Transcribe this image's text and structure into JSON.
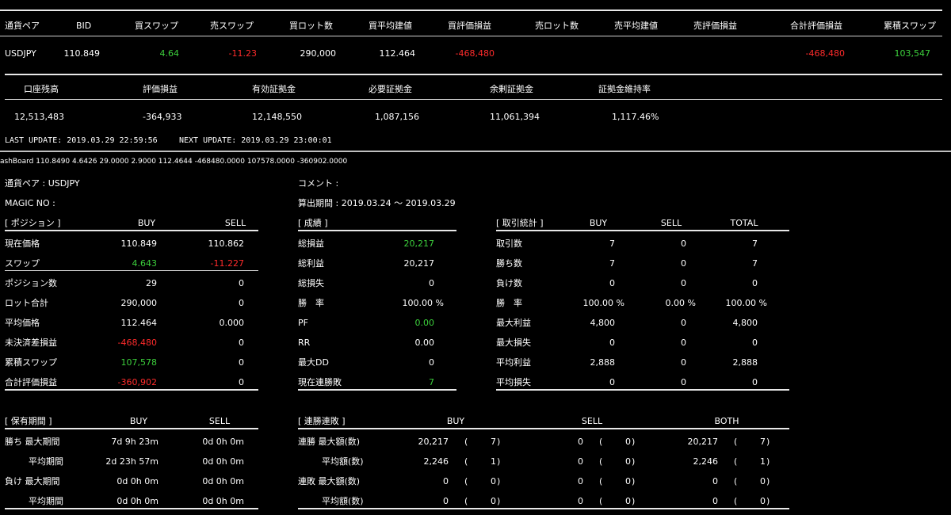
{
  "pos_header": [
    "通貨ペア",
    "BID",
    "買スワップ",
    "売スワップ",
    "買ロット数",
    "買平均建値",
    "買評価損益",
    "売ロット数",
    "売平均建値",
    "売評価損益",
    "合計評価損益",
    "累積スワップ"
  ],
  "pos_row": [
    "USDJPY",
    "110.849",
    "4.64",
    "-11.23",
    "290,000",
    "112.464",
    "-468,480",
    "",
    "",
    "",
    "-468,480",
    "103,547"
  ],
  "acct_header": [
    "口座残高",
    "評価損益",
    "有効証拠金",
    "必要証拠金",
    "余剰証拠金",
    "証拠金維持率"
  ],
  "acct_row": [
    "12,513,483",
    "-364,933",
    "12,148,550",
    "1,087,156",
    "11,061,394",
    "1,117.46%"
  ],
  "update": {
    "last": "LAST UPDATE: 2019.03.29 22:59:56",
    "next": "NEXT UPDATE: 2019.03.29 23:00:01"
  },
  "status_line": "ashBoard 110.8490 4.6426 29.0000 2.9000 112.4644 -468480.0000 107578.0000 -360902.0000",
  "info": {
    "pair": "通貨ペア : USDJPY",
    "magic": "MAGIC NO :",
    "comment": "コメント :",
    "period": "算出期間 : 2019.03.24 ～ 2019.03.29"
  },
  "position": {
    "title": "[ ポジション ]",
    "buy": "BUY",
    "sell": "SELL",
    "rows": [
      [
        "現在価格",
        "110.849",
        "110.862"
      ],
      [
        "スワップ",
        "4.643",
        "-11.227"
      ],
      [
        "ポジション数",
        "29",
        "0"
      ],
      [
        "ロット合計",
        "290,000",
        "0"
      ],
      [
        "平均価格",
        "112.464",
        "0.000"
      ],
      [
        "未決済差損益",
        "-468,480",
        "0"
      ],
      [
        "累積スワップ",
        "107,578",
        "0"
      ],
      [
        "合計評価損益",
        "-360,902",
        "0"
      ]
    ]
  },
  "results": {
    "title": "[ 成績 ]",
    "rows": [
      [
        "総損益",
        "20,217"
      ],
      [
        "総利益",
        "20,217"
      ],
      [
        "総損失",
        "0"
      ],
      [
        "勝　率",
        "100.00 %"
      ],
      [
        "PF",
        "0.00"
      ],
      [
        "RR",
        "0.00"
      ],
      [
        "最大DD",
        "0"
      ],
      [
        "現在連勝敗",
        "7"
      ]
    ]
  },
  "trade_stats": {
    "title": "[ 取引統計 ]",
    "buy": "BUY",
    "sell": "SELL",
    "total": "TOTAL",
    "rows": [
      [
        "取引数",
        "7",
        "0",
        "7"
      ],
      [
        "勝ち数",
        "7",
        "0",
        "7"
      ],
      [
        "負け数",
        "0",
        "0",
        "0"
      ],
      [
        "勝　率",
        "100.00 %",
        "0.00 %",
        "100.00 %"
      ],
      [
        "最大利益",
        "4,800",
        "0",
        "4,800"
      ],
      [
        "最大損失",
        "0",
        "0",
        "0"
      ],
      [
        "平均利益",
        "2,888",
        "0",
        "2,888"
      ],
      [
        "平均損失",
        "0",
        "0",
        "0"
      ]
    ]
  },
  "holding": {
    "title": "[ 保有期間 ]",
    "buy": "BUY",
    "sell": "SELL",
    "rows": [
      [
        "勝ち 最大期間",
        "7d  9h 23m",
        "0d  0h  0m"
      ],
      [
        "平均期間",
        "2d 23h 57m",
        "0d  0h  0m"
      ],
      [
        "負け 最大期間",
        "0d  0h  0m",
        "0d  0h  0m"
      ],
      [
        "平均期間",
        "0d  0h  0m",
        "0d  0h  0m"
      ]
    ]
  },
  "streak": {
    "title": "[ 連勝連敗 ]",
    "buy": "BUY",
    "sell": "SELL",
    "both": "BOTH",
    "rows": [
      [
        "連勝 最大額(数)",
        "20,217",
        "7",
        "0",
        "0",
        "20,217",
        "7"
      ],
      [
        "平均額(数)",
        "2,246",
        "1",
        "0",
        "0",
        "2,246",
        "1"
      ],
      [
        "連敗 最大額(数)",
        "0",
        "0",
        "0",
        "0",
        "0",
        "0"
      ],
      [
        "平均額(数)",
        "0",
        "0",
        "0",
        "0",
        "0",
        "0"
      ]
    ]
  },
  "colors": {
    "positive": "#3cd03c",
    "negative": "#ff2b2b",
    "background": "#000000",
    "text": "#ffffff"
  }
}
